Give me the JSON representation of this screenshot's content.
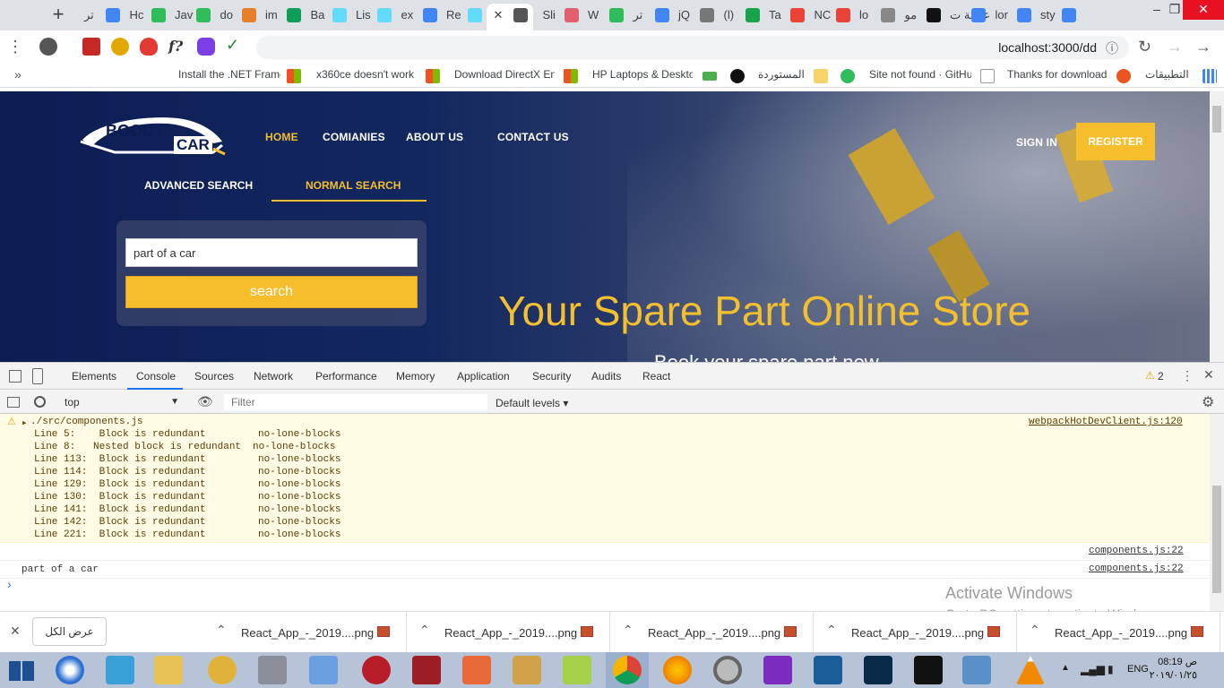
{
  "browser": {
    "tabs": [
      {
        "label": "تر"
      },
      {
        "label": "Hc"
      },
      {
        "label": "Jav"
      },
      {
        "label": "do"
      },
      {
        "label": "im"
      },
      {
        "label": "Ba"
      },
      {
        "label": "Lis"
      },
      {
        "label": "ex"
      },
      {
        "label": "Re"
      },
      {
        "label": ""
      },
      {
        "label": "Sli"
      },
      {
        "label": "W"
      },
      {
        "label": "تر"
      },
      {
        "label": "jQ"
      },
      {
        "label": "(l)"
      },
      {
        "label": "Ta"
      },
      {
        "label": "NC"
      },
      {
        "label": "lo"
      },
      {
        "label": "مو"
      },
      {
        "label": "علامة ت"
      },
      {
        "label": "lor"
      },
      {
        "label": "sty"
      }
    ],
    "url": "localhost:3000/dd",
    "bookmarks": [
      {
        "label": "Install the .NET Frame"
      },
      {
        "label": "x360ce doesn't work"
      },
      {
        "label": "Download DirectX En"
      },
      {
        "label": "HP Laptops & Deskto"
      },
      {
        "label": "المستوردة"
      },
      {
        "label": "Site not found · GitHu"
      },
      {
        "label": "Thanks for download"
      },
      {
        "label": "التطبيقات"
      }
    ]
  },
  "site": {
    "logo": {
      "line1": "BOODY",
      "line2": "CAR"
    },
    "nav": {
      "home": "HOME",
      "companies": "COMIANIES",
      "about": "ABOUT US",
      "contact": "CONTACT US"
    },
    "sign_in": "SIGN IN",
    "register": "REGISTER",
    "search_tabs": {
      "advanced": "ADVANCED SEARCH",
      "normal": "NORMAL SEARCH"
    },
    "search": {
      "value": "part of a car",
      "button": "search"
    },
    "hero": {
      "title": "Your Spare Part Online Store",
      "subtitle": "Book your spare part now"
    }
  },
  "devtools": {
    "tabs": [
      "Elements",
      "Console",
      "Sources",
      "Network",
      "Performance",
      "Memory",
      "Application",
      "Security",
      "Audits",
      "React"
    ],
    "active_tab": "Console",
    "warnings_count": "2",
    "context": "top",
    "filter_placeholder": "Filter",
    "levels": "Default levels ▾",
    "warning": {
      "file": "./src/components.js",
      "source": "webpackHotDevClient.js:120",
      "lines": [
        {
          "line": "Line 5:    Block is redundant",
          "rule": "no-lone-blocks"
        },
        {
          "line": "Line 8:   Nested block is redundant",
          "rule": "no-lone-blocks"
        },
        {
          "line": "Line 113:  Block is redundant",
          "rule": "no-lone-blocks"
        },
        {
          "line": "Line 114:  Block is redundant",
          "rule": "no-lone-blocks"
        },
        {
          "line": "Line 129:  Block is redundant",
          "rule": "no-lone-blocks"
        },
        {
          "line": "Line 130:  Block is redundant",
          "rule": "no-lone-blocks"
        },
        {
          "line": "Line 141:  Block is redundant",
          "rule": "no-lone-blocks"
        },
        {
          "line": "Line 142:  Block is redundant",
          "rule": "no-lone-blocks"
        },
        {
          "line": "Line 221:  Block is redundant",
          "rule": "no-lone-blocks"
        }
      ]
    },
    "logs": [
      {
        "text": "",
        "source": "components.js:22"
      },
      {
        "text": "part of a car",
        "source": "components.js:22"
      }
    ],
    "prompt": "›"
  },
  "watermark": {
    "title": "Activate Windows",
    "subtitle": "Go to PC settings to activate Windows."
  },
  "downloads": {
    "show_all": "عرض الكل",
    "items": [
      {
        "name": "React_App_-_2019....png"
      },
      {
        "name": "React_App_-_2019....png"
      },
      {
        "name": "React_App_-_2019....png"
      },
      {
        "name": "React_App_-_2019....png"
      },
      {
        "name": "React_App_-_2019....png"
      }
    ]
  },
  "taskbar": {
    "lang": "ENG",
    "time": "08:19 ص",
    "date": "٢٠١٩/٠١/٢٥"
  },
  "colors": {
    "accent": "#f6be2c",
    "navy": "#0d1d54",
    "chrome_link": "#1a73e8"
  }
}
